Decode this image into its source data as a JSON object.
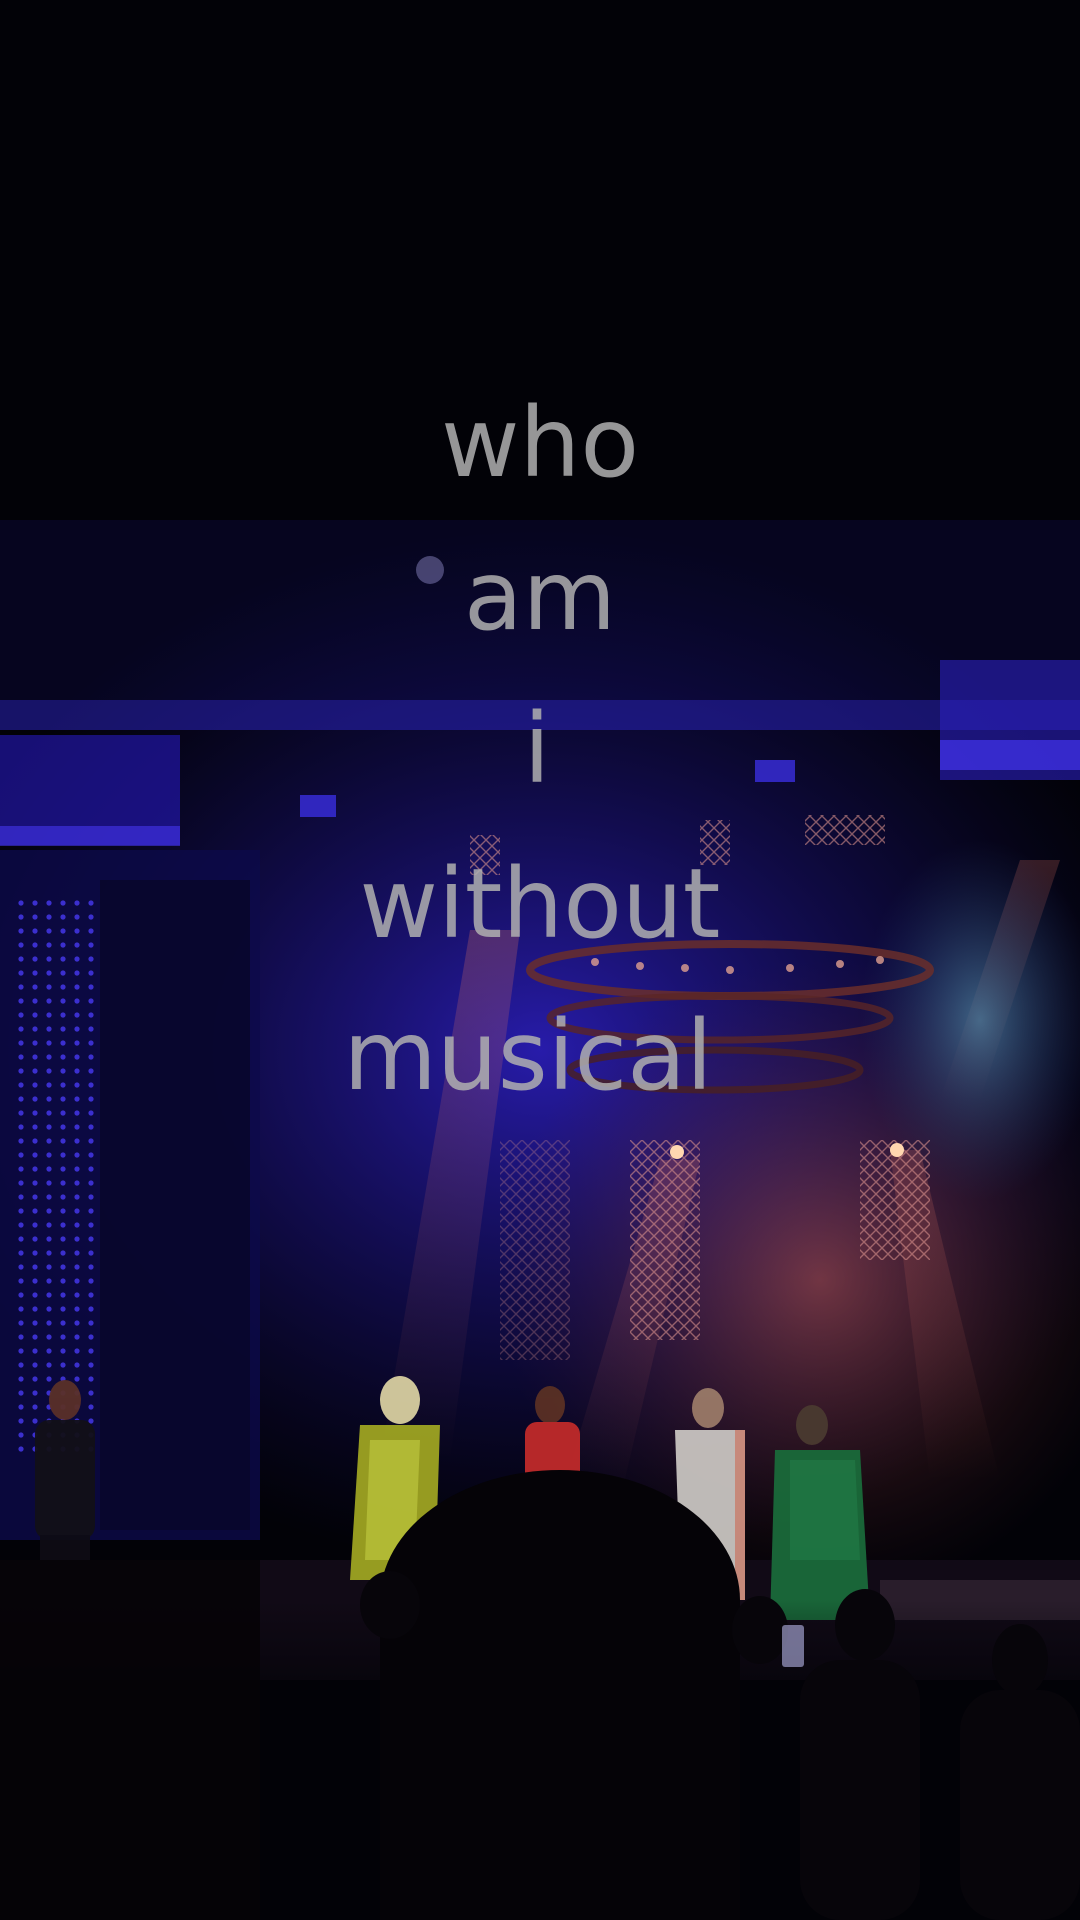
{
  "overlay_text": {
    "lines": [
      "who",
      "am",
      "i",
      "without",
      "musical"
    ],
    "color": "#b0b0b0"
  },
  "scene": {
    "palette": {
      "background": "#020207",
      "stage_blue": "#2a1fd6",
      "stage_red": "#c0504a",
      "spot_teal": "#5aa8c8"
    }
  }
}
